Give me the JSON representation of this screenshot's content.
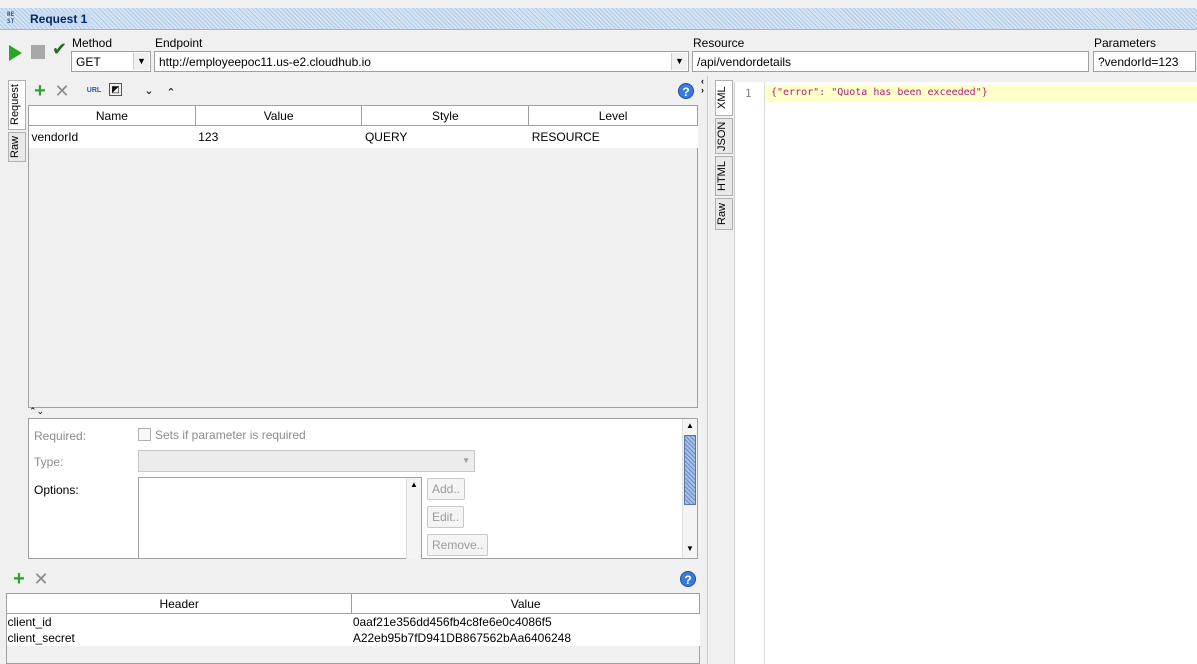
{
  "window": {
    "icon_text": "RE ST",
    "title": "Request 1"
  },
  "toolbar": {
    "method_label": "Method",
    "method_value": "GET",
    "endpoint_label": "Endpoint",
    "endpoint_value": "http://employeepoc11.us-e2.cloudhub.io",
    "resource_label": "Resource",
    "resource_value": "/api/vendordetails",
    "parameters_label": "Parameters",
    "parameters_value": "?vendorId=123"
  },
  "left_tabs": [
    "Request",
    "Raw"
  ],
  "params_table": {
    "columns": [
      "Name",
      "Value",
      "Style",
      "Level"
    ],
    "rows": [
      [
        "vendorId",
        "123",
        "QUERY",
        "RESOURCE"
      ]
    ]
  },
  "param_details": {
    "required_label": "Required:",
    "required_checkbox_label": "Sets if parameter is required",
    "type_label": "Type:",
    "options_label": "Options:",
    "add_label": "Add..",
    "edit_label": "Edit..",
    "remove_label": "Remove.."
  },
  "headers_table": {
    "columns": [
      "Header",
      "Value"
    ],
    "rows": [
      [
        "client_id",
        "0aaf21e356dd456fb4c8fe6e0c4086f5"
      ],
      [
        "client_secret",
        "A22eb95b7fD941DB867562bAa6406248"
      ]
    ]
  },
  "response_tabs": [
    "XML",
    "JSON",
    "HTML",
    "Raw"
  ],
  "response": {
    "line_number": "1",
    "content": "{\"error\": \"Quota has been exceeded\"}"
  },
  "colors": {
    "accent": "#3b7ad9",
    "highlight": "#ffffc8",
    "json_text": "#b0207c"
  }
}
